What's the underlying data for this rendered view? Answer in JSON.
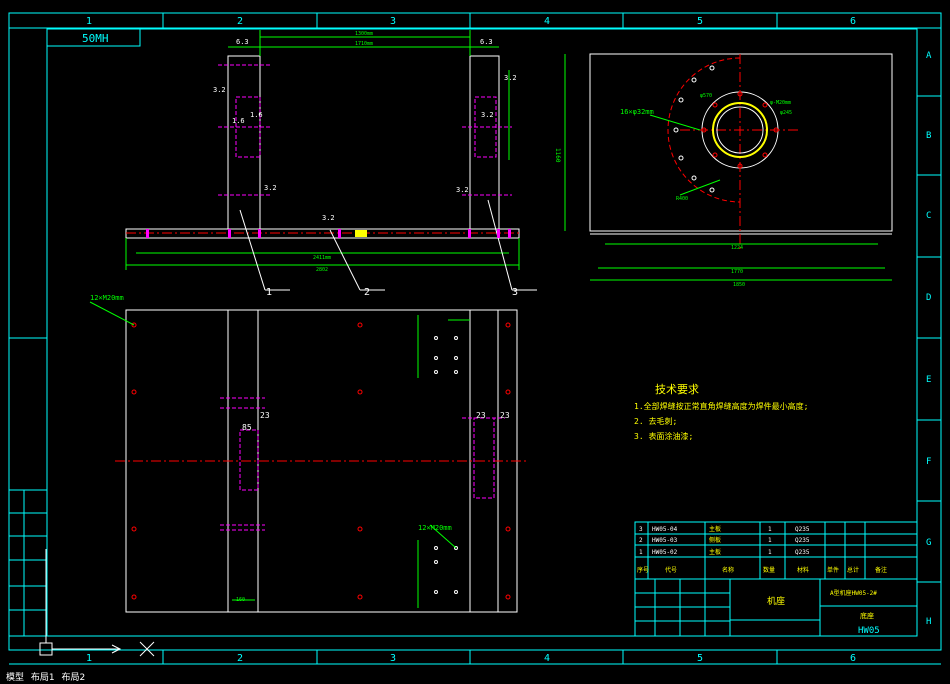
{
  "zone_columns": [
    "1",
    "2",
    "3",
    "4",
    "5",
    "6"
  ],
  "zone_rows": [
    "A",
    "B",
    "C",
    "D",
    "E",
    "F",
    "G",
    "H"
  ],
  "title_tag": "50MH",
  "front_view": {
    "dims_top": [
      "1300mm",
      "1710mm"
    ],
    "dims_bottom": [
      "2411mm",
      "2802"
    ],
    "roughness": [
      "6.3",
      "6.3",
      "3.2",
      "3.2",
      "1.6",
      "1.6",
      "3.2",
      "3.2",
      "3.2",
      "3.2"
    ],
    "balloons": [
      "1",
      "2",
      "3"
    ]
  },
  "side_view": {
    "hole_note": "16×φ32mm",
    "dims": [
      "φ570",
      "φ-M20mm",
      "φ245"
    ],
    "radius": "R400",
    "height_dim": "1160",
    "width_dims": [
      "1224",
      "1770",
      "1850"
    ]
  },
  "plan_view": {
    "hole_note_top": "12×M20mm",
    "hole_note_bottom": "12×M20mm",
    "dims": [
      "23",
      "85",
      "23",
      "23",
      "160"
    ]
  },
  "tech_requirements": {
    "title": "技术要求",
    "items": [
      "1.全部焊缝按正常直角焊缝高度为焊件最小高度;",
      "2. 去毛刺;",
      "3. 表面涂油漆;"
    ]
  },
  "bom": {
    "rows": [
      {
        "no": "3",
        "code": "HW05-04",
        "name": "主板",
        "qty": "1",
        "material": "Q235"
      },
      {
        "no": "2",
        "code": "HW05-03",
        "name": "侧板",
        "qty": "1",
        "material": "Q235"
      },
      {
        "no": "1",
        "code": "HW05-02",
        "name": "主板",
        "qty": "1",
        "material": "Q235"
      }
    ],
    "header": [
      "序号",
      "代号",
      "名称",
      "数量",
      "材料",
      "单件",
      "总计",
      "备注"
    ]
  },
  "title_block": {
    "drawing_name": "机座",
    "drawing_no": "HW05",
    "spec": "A型机座HW05-2#",
    "part": "底座"
  },
  "status_bar": {
    "tabs": [
      "模型",
      "布局1",
      "布局2"
    ]
  },
  "colors": {
    "frame": "#00ffff",
    "geometry": "#ffffff",
    "dims": "#00ff00",
    "centerline": "#ff0000",
    "hidden": "#ff00ff",
    "text": "#ffff00"
  }
}
